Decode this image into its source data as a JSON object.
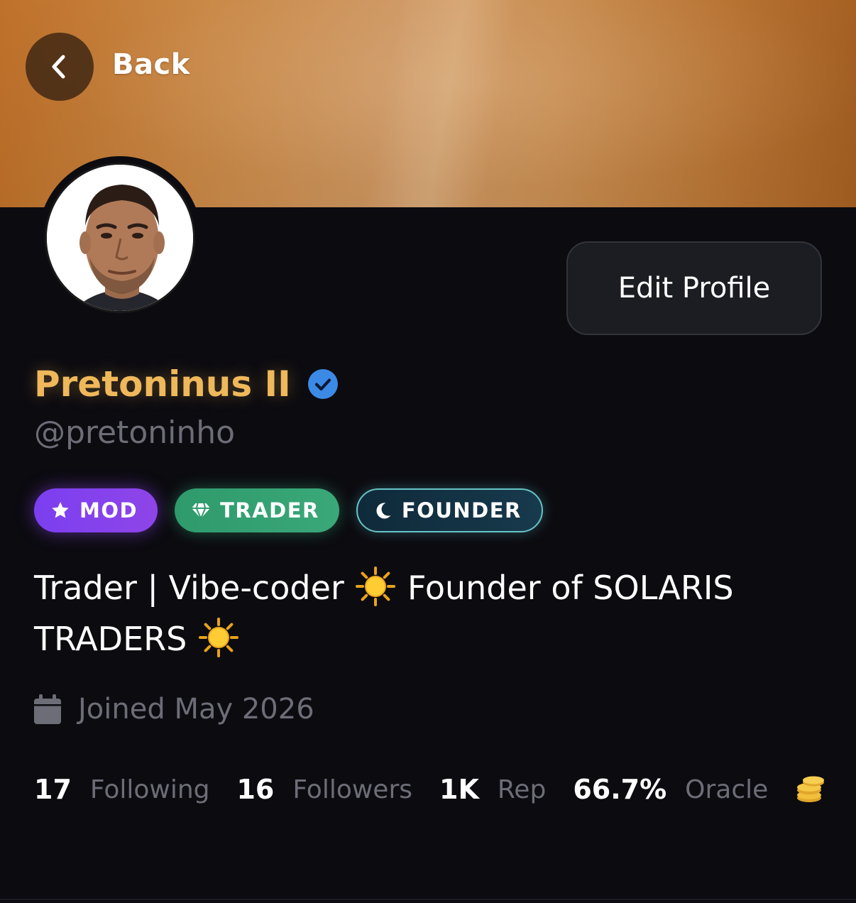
{
  "header": {
    "back_label": "Back"
  },
  "profile": {
    "display_name": "Pretoninus II",
    "handle": "@pretoninho",
    "verified": true,
    "edit_button_label": "Edit Profile"
  },
  "badges": [
    {
      "label": "MOD",
      "icon": "star-icon",
      "color": "#7b3ff0"
    },
    {
      "label": "TRADER",
      "icon": "diamond-icon",
      "color": "#2f9a6c"
    },
    {
      "label": "FOUNDER",
      "icon": "moon-icon",
      "color": "#173a4c"
    }
  ],
  "bio": {
    "part1": "Trader | Vibe-coder",
    "part2": "Founder of SOLARIS TRADERS",
    "emoji": "sun-emoji"
  },
  "joined": {
    "icon": "calendar-icon",
    "text": "Joined May 2026"
  },
  "stats": {
    "following": {
      "value": "17",
      "label": "Following"
    },
    "followers": {
      "value": "16",
      "label": "Followers"
    },
    "rep": {
      "value": "1K",
      "label": "Rep"
    },
    "oracle": {
      "value": "66.7%",
      "label": "Oracle"
    },
    "coins_icon": "coins-icon"
  },
  "colors": {
    "accent_name": "#efb85a",
    "verified": "#3b8ae6",
    "background": "#0c0b10"
  }
}
